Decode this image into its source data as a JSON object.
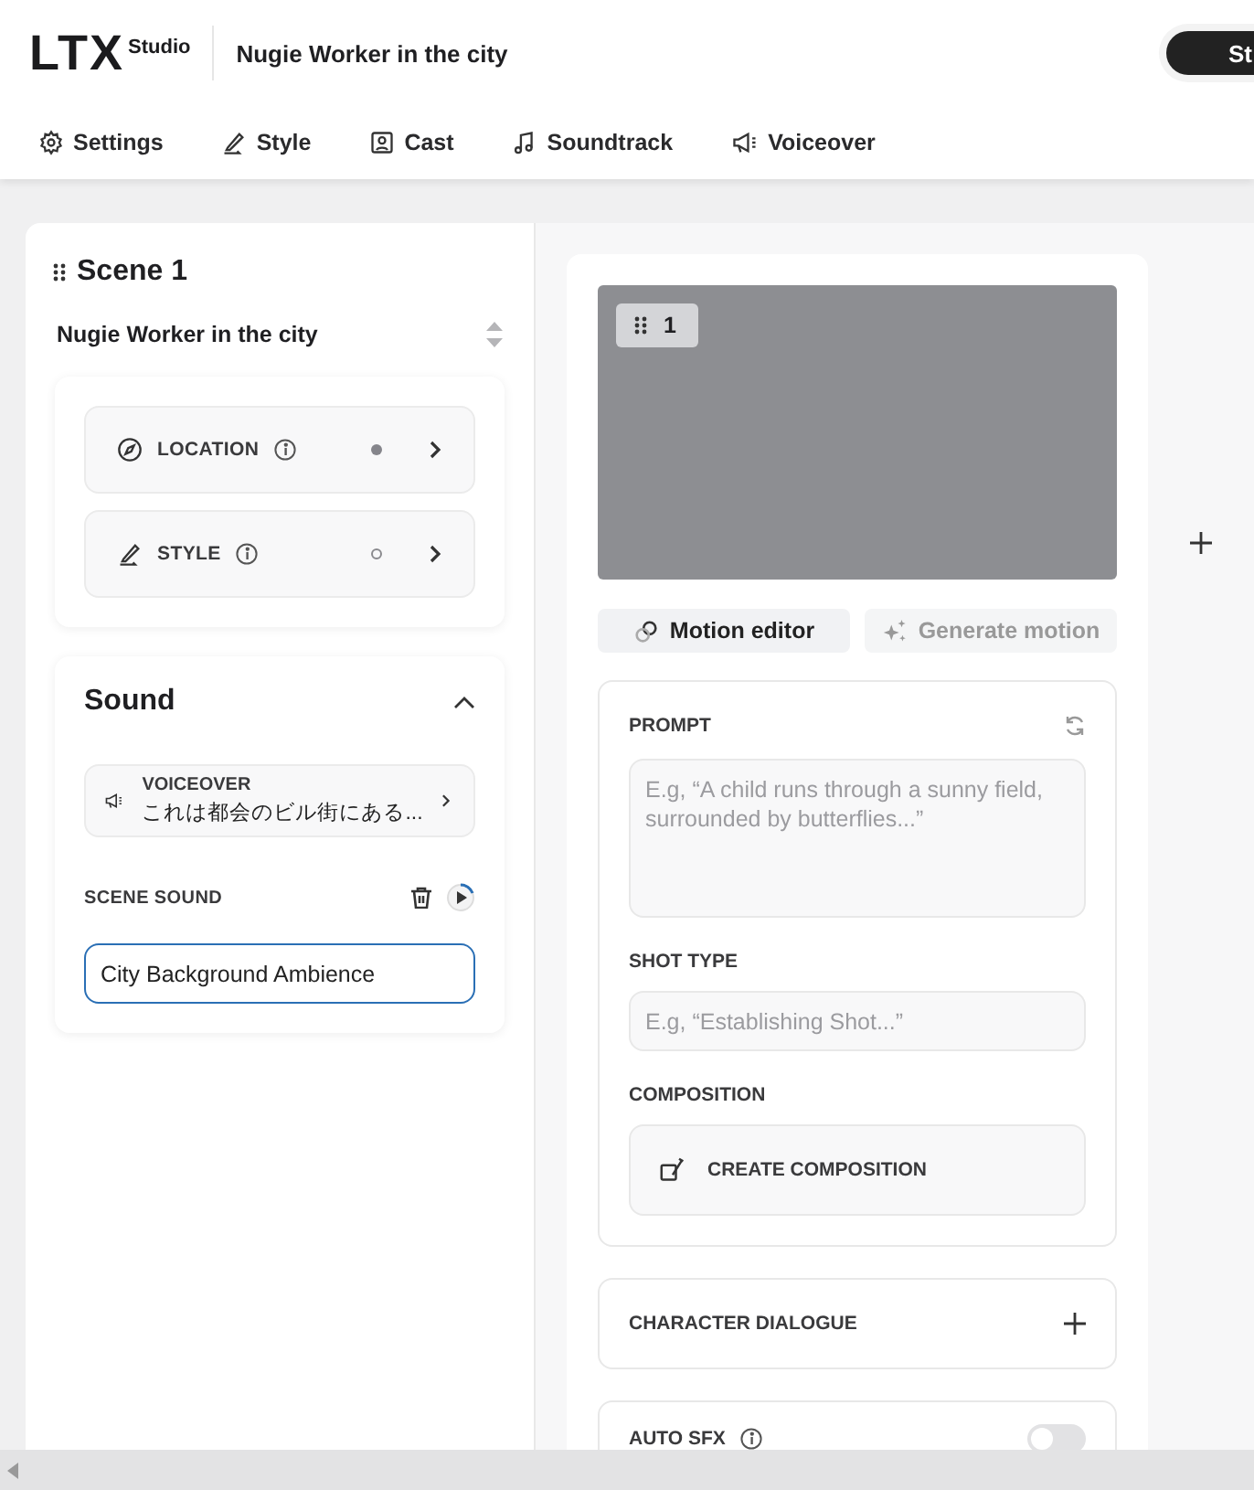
{
  "header": {
    "logo": "LTX",
    "logo_sub": "Studio",
    "project_title": "Nugie Worker in the city",
    "action_button": "St"
  },
  "toolbar": [
    {
      "label": "Settings"
    },
    {
      "label": "Style"
    },
    {
      "label": "Cast"
    },
    {
      "label": "Soundtrack"
    },
    {
      "label": "Voiceover"
    }
  ],
  "scene": {
    "title": "Scene 1",
    "name": "Nugie Worker in the city",
    "attributes": [
      {
        "label": "LOCATION",
        "set": true
      },
      {
        "label": "STYLE",
        "set": false
      }
    ],
    "sound": {
      "title": "Sound",
      "expanded": true,
      "voiceover": {
        "label": "VOICEOVER",
        "text": "これは都会のビル街にある..."
      },
      "scene_sound": {
        "label": "SCENE SOUND",
        "value": "City Background Ambience",
        "focused": true
      }
    }
  },
  "shot": {
    "number": "1",
    "actions": [
      {
        "label": "Motion editor",
        "disabled": false
      },
      {
        "label": "Generate motion",
        "disabled": true
      }
    ],
    "prompt": {
      "label": "PROMPT",
      "placeholder": "E.g, “A child runs through a sunny field, surrounded by butterflies...”"
    },
    "shot_type": {
      "label": "SHOT TYPE",
      "placeholder": "E.g, “Establishing Shot...”"
    },
    "composition": {
      "label": "COMPOSITION",
      "button": "CREATE COMPOSITION"
    },
    "character_dialogue": {
      "label": "CHARACTER DIALOGUE"
    },
    "auto_sfx": {
      "label": "AUTO SFX",
      "on": false
    }
  }
}
